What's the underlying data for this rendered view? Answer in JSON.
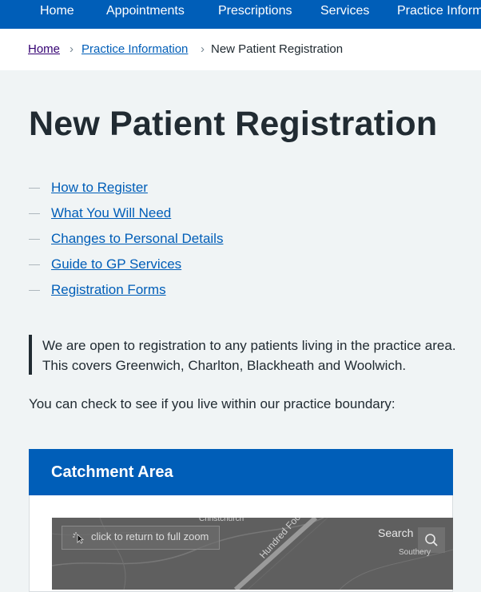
{
  "nav": {
    "items": [
      {
        "label": "Home"
      },
      {
        "label": "Appointments"
      },
      {
        "label": "Prescriptions"
      },
      {
        "label": "Services"
      },
      {
        "label": "Practice Informa"
      }
    ]
  },
  "breadcrumb": {
    "items": [
      {
        "label": "Home"
      },
      {
        "label": "Practice Information"
      },
      {
        "label": "New Patient Registration"
      }
    ]
  },
  "page": {
    "title": "New Patient Registration",
    "contents": [
      {
        "label": "How to Register"
      },
      {
        "label": "What You Will Need"
      },
      {
        "label": "Changes to Personal Details"
      },
      {
        "label": "Guide to GP Services"
      },
      {
        "label": "Registration Forms"
      }
    ],
    "inset_text": "We are open to registration to any patients living in the practice area. This covers Greenwich, Charlton, Blackheath and Woolwich.",
    "check_text": "You can check to see if you live within our practice boundary:"
  },
  "card": {
    "title": "Catchment Area"
  },
  "map": {
    "zoom_label": "click to return to full zoom",
    "search_label": "Search",
    "places": [
      "Christchurch",
      "Southery"
    ],
    "road_label": "Hundred Foot Washes"
  },
  "colors": {
    "brand_blue": "#005eb8",
    "page_bg": "#f0f4f5",
    "text": "#212b32",
    "visited_link": "#330072"
  }
}
